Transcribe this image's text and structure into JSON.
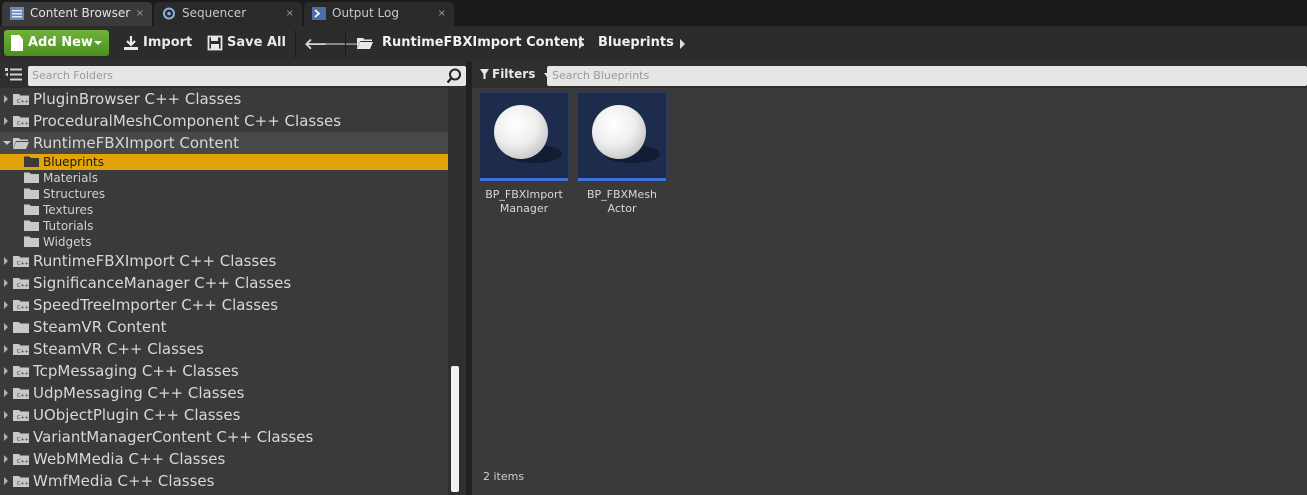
{
  "tabs": [
    {
      "label": "Content Browser",
      "icon": "content-browser-icon",
      "active": true
    },
    {
      "label": "Sequencer",
      "icon": "sequencer-icon",
      "active": false
    },
    {
      "label": "Output Log",
      "icon": "output-log-icon",
      "active": false
    }
  ],
  "tab_close_glyph": "×",
  "toolbar": {
    "add_new_label": "Add New",
    "import_label": "Import",
    "save_all_label": "Save All"
  },
  "breadcrumb": [
    "RuntimeFBXImport Content",
    "Blueprints"
  ],
  "left": {
    "search_placeholder": "Search Folders",
    "tree": [
      {
        "label": "PluginBrowser C++ Classes",
        "icon": "cpp-folder-icon"
      },
      {
        "label": "ProceduralMeshComponent C++ Classes",
        "icon": "cpp-folder-icon"
      },
      {
        "label": "RuntimeFBXImport Content",
        "icon": "open-folder-icon",
        "expanded": true,
        "children": [
          "Blueprints",
          "Materials",
          "Structures",
          "Textures",
          "Tutorials",
          "Widgets"
        ],
        "selected_child": "Blueprints"
      },
      {
        "label": "RuntimeFBXImport C++ Classes",
        "icon": "cpp-folder-icon"
      },
      {
        "label": "SignificanceManager C++ Classes",
        "icon": "cpp-folder-icon"
      },
      {
        "label": "SpeedTreeImporter C++ Classes",
        "icon": "cpp-folder-icon"
      },
      {
        "label": "SteamVR Content",
        "icon": "folder-icon"
      },
      {
        "label": "SteamVR C++ Classes",
        "icon": "cpp-folder-icon"
      },
      {
        "label": "TcpMessaging C++ Classes",
        "icon": "cpp-folder-icon"
      },
      {
        "label": "UdpMessaging C++ Classes",
        "icon": "cpp-folder-icon"
      },
      {
        "label": "UObjectPlugin C++ Classes",
        "icon": "cpp-folder-icon"
      },
      {
        "label": "VariantManagerContent C++ Classes",
        "icon": "cpp-folder-icon"
      },
      {
        "label": "WebMMedia C++ Classes",
        "icon": "cpp-folder-icon"
      },
      {
        "label": "WmfMedia C++ Classes",
        "icon": "cpp-folder-icon"
      }
    ]
  },
  "right": {
    "filters_label": "Filters",
    "search_placeholder": "Search Blueprints",
    "assets": [
      {
        "name_line1": "BP_FBXImport",
        "name_line2": "Manager"
      },
      {
        "name_line1": "BP_FBXMesh",
        "name_line2": "Actor"
      }
    ],
    "item_count": "2 items"
  },
  "colors": {
    "accent_selected": "#e3a40a",
    "add_new_green": "#5da22c",
    "asset_underline": "#3f72d8"
  }
}
